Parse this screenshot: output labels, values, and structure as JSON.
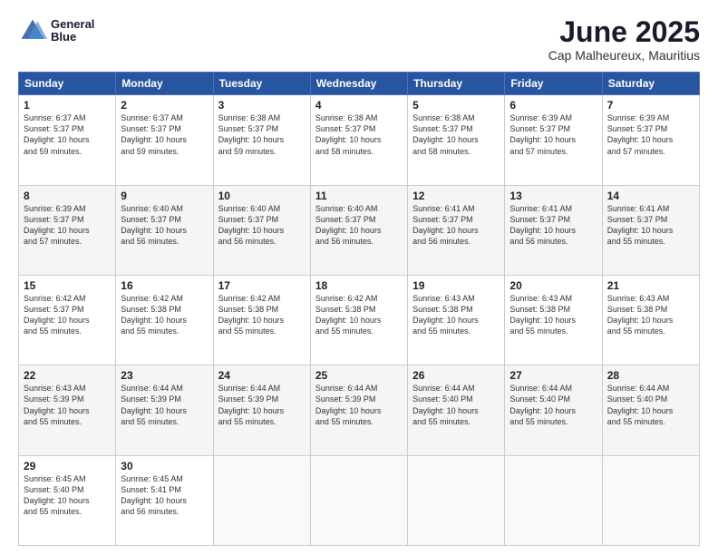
{
  "header": {
    "logo_line1": "General",
    "logo_line2": "Blue",
    "month_title": "June 2025",
    "location": "Cap Malheureux, Mauritius"
  },
  "weekdays": [
    "Sunday",
    "Monday",
    "Tuesday",
    "Wednesday",
    "Thursday",
    "Friday",
    "Saturday"
  ],
  "weeks": [
    [
      {
        "day": "1",
        "lines": [
          "Sunrise: 6:37 AM",
          "Sunset: 5:37 PM",
          "Daylight: 10 hours",
          "and 59 minutes."
        ]
      },
      {
        "day": "2",
        "lines": [
          "Sunrise: 6:37 AM",
          "Sunset: 5:37 PM",
          "Daylight: 10 hours",
          "and 59 minutes."
        ]
      },
      {
        "day": "3",
        "lines": [
          "Sunrise: 6:38 AM",
          "Sunset: 5:37 PM",
          "Daylight: 10 hours",
          "and 59 minutes."
        ]
      },
      {
        "day": "4",
        "lines": [
          "Sunrise: 6:38 AM",
          "Sunset: 5:37 PM",
          "Daylight: 10 hours",
          "and 58 minutes."
        ]
      },
      {
        "day": "5",
        "lines": [
          "Sunrise: 6:38 AM",
          "Sunset: 5:37 PM",
          "Daylight: 10 hours",
          "and 58 minutes."
        ]
      },
      {
        "day": "6",
        "lines": [
          "Sunrise: 6:39 AM",
          "Sunset: 5:37 PM",
          "Daylight: 10 hours",
          "and 57 minutes."
        ]
      },
      {
        "day": "7",
        "lines": [
          "Sunrise: 6:39 AM",
          "Sunset: 5:37 PM",
          "Daylight: 10 hours",
          "and 57 minutes."
        ]
      }
    ],
    [
      {
        "day": "8",
        "lines": [
          "Sunrise: 6:39 AM",
          "Sunset: 5:37 PM",
          "Daylight: 10 hours",
          "and 57 minutes."
        ]
      },
      {
        "day": "9",
        "lines": [
          "Sunrise: 6:40 AM",
          "Sunset: 5:37 PM",
          "Daylight: 10 hours",
          "and 56 minutes."
        ]
      },
      {
        "day": "10",
        "lines": [
          "Sunrise: 6:40 AM",
          "Sunset: 5:37 PM",
          "Daylight: 10 hours",
          "and 56 minutes."
        ]
      },
      {
        "day": "11",
        "lines": [
          "Sunrise: 6:40 AM",
          "Sunset: 5:37 PM",
          "Daylight: 10 hours",
          "and 56 minutes."
        ]
      },
      {
        "day": "12",
        "lines": [
          "Sunrise: 6:41 AM",
          "Sunset: 5:37 PM",
          "Daylight: 10 hours",
          "and 56 minutes."
        ]
      },
      {
        "day": "13",
        "lines": [
          "Sunrise: 6:41 AM",
          "Sunset: 5:37 PM",
          "Daylight: 10 hours",
          "and 56 minutes."
        ]
      },
      {
        "day": "14",
        "lines": [
          "Sunrise: 6:41 AM",
          "Sunset: 5:37 PM",
          "Daylight: 10 hours",
          "and 55 minutes."
        ]
      }
    ],
    [
      {
        "day": "15",
        "lines": [
          "Sunrise: 6:42 AM",
          "Sunset: 5:37 PM",
          "Daylight: 10 hours",
          "and 55 minutes."
        ]
      },
      {
        "day": "16",
        "lines": [
          "Sunrise: 6:42 AM",
          "Sunset: 5:38 PM",
          "Daylight: 10 hours",
          "and 55 minutes."
        ]
      },
      {
        "day": "17",
        "lines": [
          "Sunrise: 6:42 AM",
          "Sunset: 5:38 PM",
          "Daylight: 10 hours",
          "and 55 minutes."
        ]
      },
      {
        "day": "18",
        "lines": [
          "Sunrise: 6:42 AM",
          "Sunset: 5:38 PM",
          "Daylight: 10 hours",
          "and 55 minutes."
        ]
      },
      {
        "day": "19",
        "lines": [
          "Sunrise: 6:43 AM",
          "Sunset: 5:38 PM",
          "Daylight: 10 hours",
          "and 55 minutes."
        ]
      },
      {
        "day": "20",
        "lines": [
          "Sunrise: 6:43 AM",
          "Sunset: 5:38 PM",
          "Daylight: 10 hours",
          "and 55 minutes."
        ]
      },
      {
        "day": "21",
        "lines": [
          "Sunrise: 6:43 AM",
          "Sunset: 5:38 PM",
          "Daylight: 10 hours",
          "and 55 minutes."
        ]
      }
    ],
    [
      {
        "day": "22",
        "lines": [
          "Sunrise: 6:43 AM",
          "Sunset: 5:39 PM",
          "Daylight: 10 hours",
          "and 55 minutes."
        ]
      },
      {
        "day": "23",
        "lines": [
          "Sunrise: 6:44 AM",
          "Sunset: 5:39 PM",
          "Daylight: 10 hours",
          "and 55 minutes."
        ]
      },
      {
        "day": "24",
        "lines": [
          "Sunrise: 6:44 AM",
          "Sunset: 5:39 PM",
          "Daylight: 10 hours",
          "and 55 minutes."
        ]
      },
      {
        "day": "25",
        "lines": [
          "Sunrise: 6:44 AM",
          "Sunset: 5:39 PM",
          "Daylight: 10 hours",
          "and 55 minutes."
        ]
      },
      {
        "day": "26",
        "lines": [
          "Sunrise: 6:44 AM",
          "Sunset: 5:40 PM",
          "Daylight: 10 hours",
          "and 55 minutes."
        ]
      },
      {
        "day": "27",
        "lines": [
          "Sunrise: 6:44 AM",
          "Sunset: 5:40 PM",
          "Daylight: 10 hours",
          "and 55 minutes."
        ]
      },
      {
        "day": "28",
        "lines": [
          "Sunrise: 6:44 AM",
          "Sunset: 5:40 PM",
          "Daylight: 10 hours",
          "and 55 minutes."
        ]
      }
    ],
    [
      {
        "day": "29",
        "lines": [
          "Sunrise: 6:45 AM",
          "Sunset: 5:40 PM",
          "Daylight: 10 hours",
          "and 55 minutes."
        ]
      },
      {
        "day": "30",
        "lines": [
          "Sunrise: 6:45 AM",
          "Sunset: 5:41 PM",
          "Daylight: 10 hours",
          "and 56 minutes."
        ]
      },
      {
        "day": "",
        "lines": []
      },
      {
        "day": "",
        "lines": []
      },
      {
        "day": "",
        "lines": []
      },
      {
        "day": "",
        "lines": []
      },
      {
        "day": "",
        "lines": []
      }
    ]
  ]
}
